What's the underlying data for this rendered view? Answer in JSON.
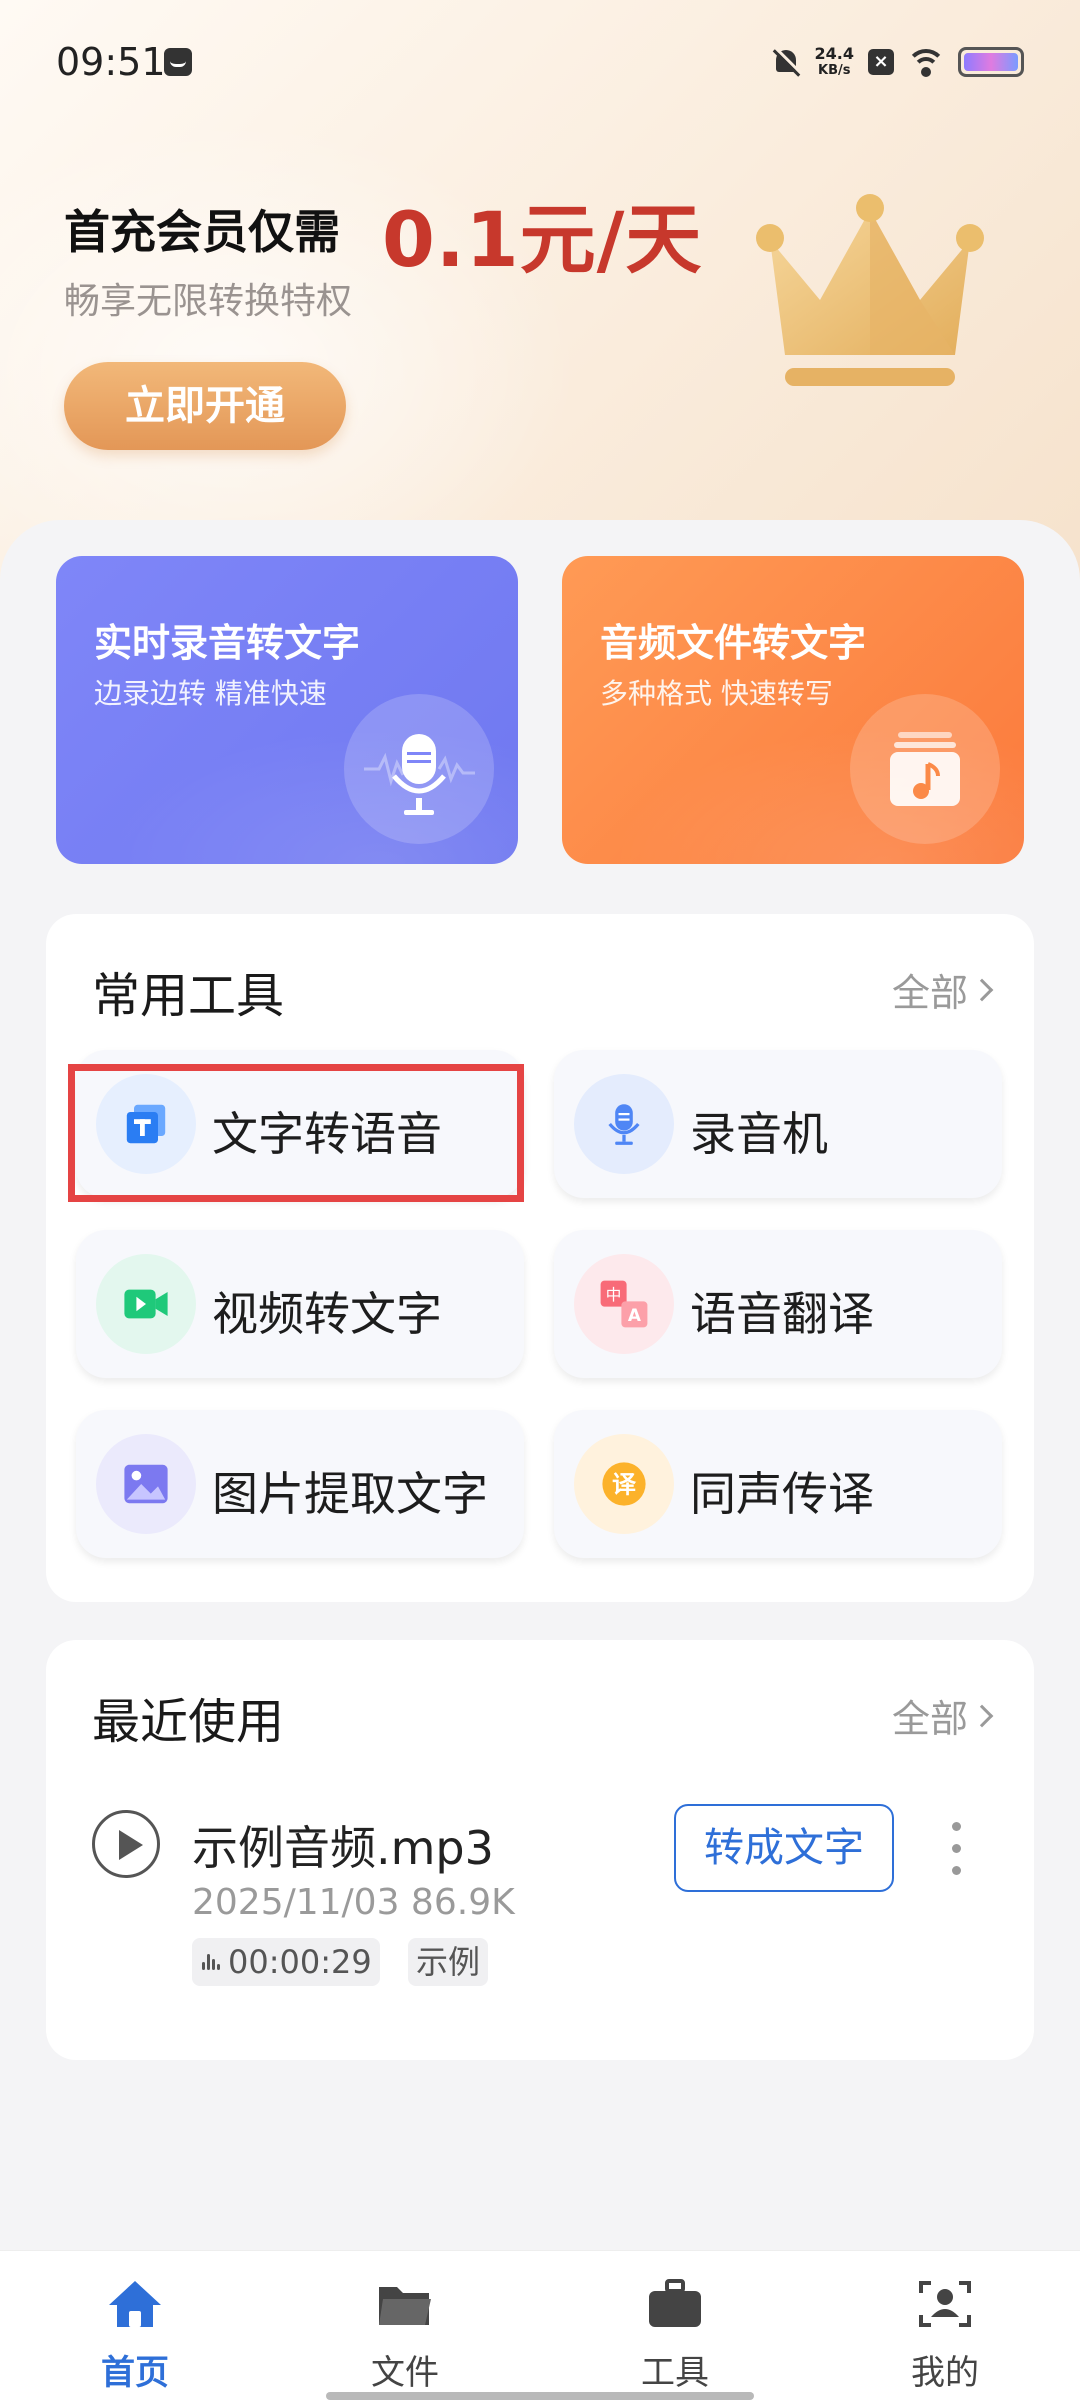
{
  "status_bar": {
    "time": "09:51",
    "net_speed_value": "24.4",
    "net_speed_unit": "KB/s",
    "icons": [
      "message-icon",
      "mute-bell-icon",
      "close-box-icon",
      "wifi-icon",
      "battery-icon"
    ]
  },
  "promo": {
    "title": "首充会员仅需",
    "price": "0.1元/天",
    "subtitle": "畅享无限转换特权",
    "cta_label": "立即开通",
    "icon": "crown-icon",
    "price_color": "#c7382c"
  },
  "features": [
    {
      "title": "实时录音转文字",
      "subtitle": "边录边转  精准快速",
      "icon": "microphone-icon",
      "color": "#7b83f6"
    },
    {
      "title": "音频文件转文字",
      "subtitle": "多种格式  快速转写",
      "icon": "music-file-icon",
      "color": "#fd8a48"
    }
  ],
  "tools": {
    "title": "常用工具",
    "all_label": "全部",
    "items": [
      {
        "label": "文字转语音",
        "icon": "text-to-speech-icon"
      },
      {
        "label": "录音机",
        "icon": "microphone-icon"
      },
      {
        "label": "视频转文字",
        "icon": "video-camera-icon"
      },
      {
        "label": "语音翻译",
        "icon": "translate-icon"
      },
      {
        "label": "图片提取文字",
        "icon": "image-icon"
      },
      {
        "label": "同声传译",
        "icon": "interpret-icon"
      }
    ]
  },
  "recent": {
    "title": "最近使用",
    "all_label": "全部",
    "items": [
      {
        "name": "示例音频.mp3",
        "meta": "2025/11/03 86.9K",
        "duration": "00:00:29",
        "tag": "示例",
        "action": "转成文字"
      }
    ]
  },
  "tabbar": {
    "items": [
      {
        "label": "首页",
        "icon": "home-icon",
        "active": true
      },
      {
        "label": "文件",
        "icon": "folder-icon",
        "active": false
      },
      {
        "label": "工具",
        "icon": "toolbox-icon",
        "active": false
      },
      {
        "label": "我的",
        "icon": "profile-icon",
        "active": false
      }
    ],
    "accent": "#2e6fd8"
  }
}
